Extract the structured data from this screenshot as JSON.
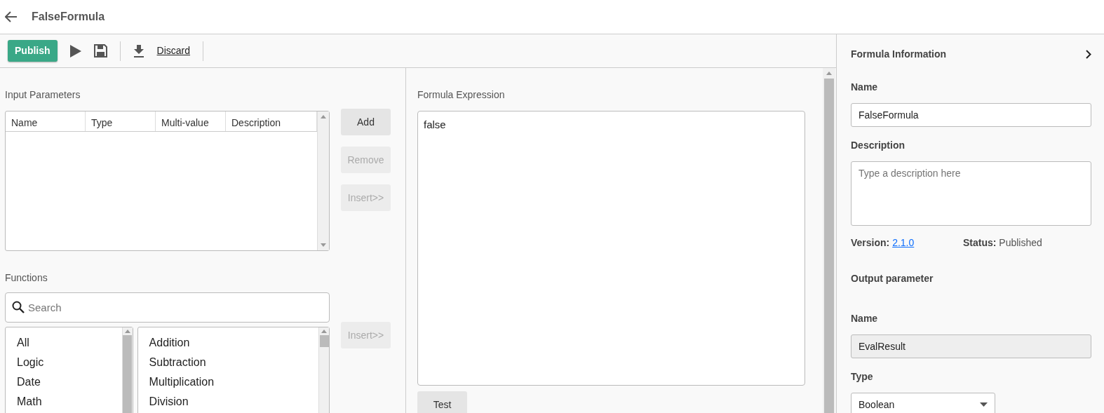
{
  "header": {
    "title": "FalseFormula"
  },
  "toolbar": {
    "publish": "Publish",
    "discard": "Discard"
  },
  "input_parameters": {
    "label": "Input Parameters",
    "columns": [
      "Name",
      "Type",
      "Multi-value",
      "Description"
    ],
    "buttons": [
      {
        "label": "Add",
        "disabled": false
      },
      {
        "label": "Remove",
        "disabled": true
      },
      {
        "label": "Insert>>",
        "disabled": true
      }
    ]
  },
  "functions": {
    "label": "Functions",
    "search_placeholder": "Search",
    "categories": [
      "All",
      "Logic",
      "Date",
      "Math"
    ],
    "items": [
      "Addition",
      "Subtraction",
      "Multiplication",
      "Division"
    ],
    "insert_button": {
      "label": "Insert>>",
      "disabled": true
    }
  },
  "formula": {
    "label": "Formula Expression",
    "value": "false",
    "test_button": {
      "label": "Test",
      "disabled": false
    }
  },
  "info": {
    "title": "Formula Information",
    "name_label": "Name",
    "name_value": "FalseFormula",
    "description_label": "Description",
    "description_placeholder": "Type a description here",
    "version_label": "Version:",
    "version": "2.1.0",
    "status_label": "Status:",
    "status": "Published",
    "output_title": "Output parameter",
    "output_name_label": "Name",
    "output_name": "EvalResult",
    "type_label": "Type",
    "type_value": "Boolean"
  }
}
